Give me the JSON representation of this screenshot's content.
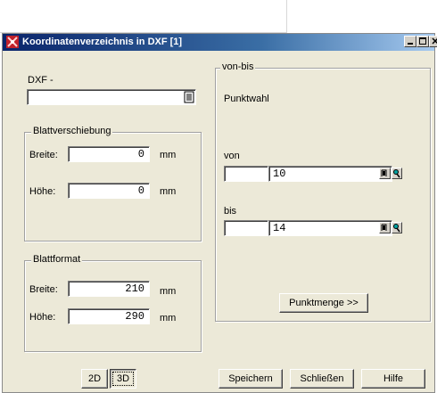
{
  "window": {
    "title": "Koordinatenverzeichnis in DXF [1]"
  },
  "dxf": {
    "label": "DXF -",
    "value": ""
  },
  "blattverschiebung": {
    "legend": "Blattverschiebung",
    "breite_label": "Breite:",
    "breite_value": "0",
    "breite_unit": "mm",
    "hoehe_label": "Höhe:",
    "hoehe_value": "0",
    "hoehe_unit": "mm"
  },
  "blattformat": {
    "legend": "Blattformat",
    "breite_label": "Breite:",
    "breite_value": "210",
    "breite_unit": "mm",
    "hoehe_label": "Höhe:",
    "hoehe_value": "290",
    "hoehe_unit": "mm"
  },
  "vonbis": {
    "legend": "von-bis",
    "punktwahl": "Punktwahl",
    "von_label": "von",
    "von_prefix": "",
    "von_value": "10",
    "bis_label": "bis",
    "bis_prefix": "",
    "bis_value": "14",
    "punktmenge_label": "Punktmenge >>"
  },
  "mode": {
    "btn_2d": "2D",
    "btn_3d": "3D",
    "selected": "3D"
  },
  "actions": {
    "save": "Speichern",
    "close": "Schließen",
    "help": "Hilfe"
  },
  "colors": {
    "titlebar_start": "#0a246a",
    "titlebar_end": "#a6caf0",
    "dialog_bg": "#ece9d8"
  },
  "icons": [
    "app-icon",
    "minimize-icon",
    "maximize-icon",
    "close-icon",
    "browse-file-icon",
    "point-select-icon",
    "pick-icon"
  ]
}
